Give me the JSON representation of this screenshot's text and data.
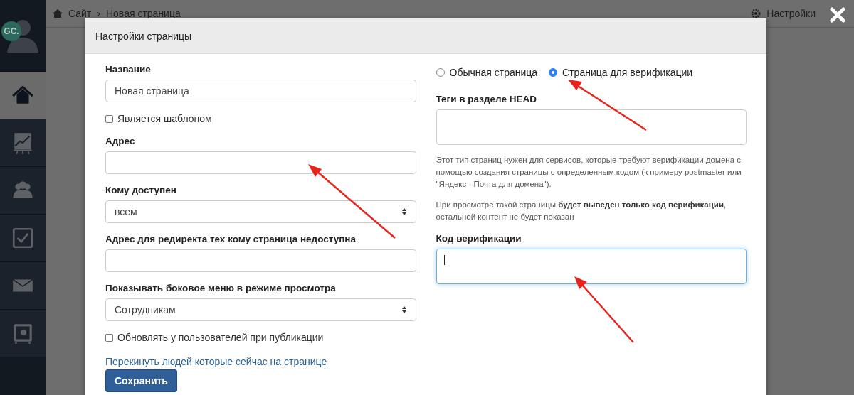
{
  "background": {
    "breadcrumb_separator": "›",
    "breadcrumb": [
      {
        "label": "Сайт"
      },
      {
        "label": "Новая страница"
      }
    ],
    "settings_link": "Настройки"
  },
  "sidebar": {
    "avatar_initials": "GC.",
    "items": [
      {
        "kind": "home",
        "selected": true
      },
      {
        "kind": "chart",
        "selected": false
      },
      {
        "kind": "users",
        "selected": false
      },
      {
        "kind": "tasks",
        "selected": false
      },
      {
        "kind": "mail",
        "selected": false
      },
      {
        "kind": "safe",
        "selected": false
      }
    ]
  },
  "dialog": {
    "title": "Настройки страницы",
    "left": [
      {
        "kind": "text",
        "label": "Название",
        "value": "Новая страница"
      },
      {
        "kind": "checkbox",
        "label": "Является шаблоном",
        "checked": false
      },
      {
        "kind": "text",
        "label": "Адрес"
      },
      {
        "kind": "select",
        "label": "Кому доступен",
        "value": "всем"
      },
      {
        "kind": "text",
        "label": "Адрес для редиректа тех кому страница недоступна"
      },
      {
        "kind": "select",
        "label": "Показывать боковое меню в режиме просмотра",
        "value": "Сотрудникам"
      },
      {
        "kind": "checkbox",
        "label": "Обновлять у пользователей при публикации",
        "checked": false
      },
      {
        "kind": "link",
        "label": "Перекинуть людей которые сейчас на странице"
      },
      {
        "kind": "button",
        "label": "Сохранить"
      }
    ],
    "page_types": [
      {
        "label": "Обычная страница",
        "selected": false
      },
      {
        "label": "Страница для верификации",
        "selected": true
      }
    ],
    "right": [
      {
        "kind": "textarea",
        "label": "Теги в разделе HEAD",
        "focused": false
      },
      {
        "kind": "help",
        "text": "Этот тип страниц нужен для сервисов, которые требуют верификации домена с помощью создания страницы с определенным кодом (к примеру postmaster или \"Яндекс - Почта для домена\")."
      },
      {
        "kind": "help",
        "text": "При просмотре такой страницы **будет выведен только код верификации**, остальной контент не будет показан"
      },
      {
        "kind": "textarea",
        "label": "Код верификации",
        "focused": true
      }
    ]
  }
}
